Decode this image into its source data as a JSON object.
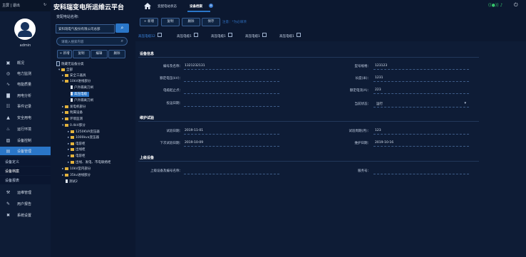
{
  "app": {
    "title": "安科瑞变电所运维云平台",
    "top_left_text": "主屏 | 退出",
    "user": "admin"
  },
  "nav": {
    "items": [
      {
        "label": "概况",
        "icon": "monitor-icon"
      },
      {
        "label": "电力监测",
        "icon": "gauge-icon"
      },
      {
        "label": "电能质量",
        "icon": "wave-icon"
      },
      {
        "label": "用电分析",
        "icon": "bar-chart-icon"
      },
      {
        "label": "事件记录",
        "icon": "clipboard-icon"
      },
      {
        "label": "安全用电",
        "icon": "shield-icon"
      },
      {
        "label": "运行环境",
        "icon": "thermometer-icon"
      },
      {
        "label": "设备控制",
        "icon": "control-icon"
      },
      {
        "label": "设备管理",
        "icon": "device-icon"
      }
    ],
    "sub_items": [
      "设备定义",
      "设备档案",
      "设备报表"
    ],
    "bottom_items": [
      {
        "label": "运维管理",
        "icon": "tools-icon"
      },
      {
        "label": "用户报告",
        "icon": "report-icon"
      },
      {
        "label": "系统设置",
        "icon": "settings-icon"
      }
    ]
  },
  "tree_panel": {
    "unit_label": "变配电站名称:",
    "unit_value": "安科瑞电气股份有限公司总部",
    "search_placeholder": "请输入搜索内容",
    "buttons": [
      "+ 新增",
      "复制",
      "编辑",
      "删除"
    ],
    "nodes": [
      {
        "label": "隐藏无设备分类",
        "depth": 0,
        "kind": "check"
      },
      {
        "label": "全部",
        "depth": 0,
        "kind": "folder"
      },
      {
        "label": "安全工器具",
        "depth": 1,
        "kind": "folder"
      },
      {
        "label": "10kV进线部分",
        "depth": 1,
        "kind": "folder"
      },
      {
        "label": "户外隔离刀闸",
        "depth": 2,
        "kind": "doc"
      },
      {
        "label": "高压电缆",
        "depth": 2,
        "kind": "doc",
        "selected": true
      },
      {
        "label": "户外隔离刀闸",
        "depth": 2,
        "kind": "doc"
      },
      {
        "label": "发电机部分",
        "depth": 1,
        "kind": "folder"
      },
      {
        "label": "附属设备",
        "depth": 1,
        "kind": "folder"
      },
      {
        "label": "环境监测",
        "depth": 1,
        "kind": "folder"
      },
      {
        "label": "0.4kV部分",
        "depth": 1,
        "kind": "folder"
      },
      {
        "label": "1250KVA变压器",
        "depth": 2,
        "kind": "folder"
      },
      {
        "label": "1000kva变压器",
        "depth": 2,
        "kind": "folder"
      },
      {
        "label": "电容柜",
        "depth": 2,
        "kind": "folder"
      },
      {
        "label": "出线柜",
        "depth": 2,
        "kind": "folder"
      },
      {
        "label": "电容柜",
        "depth": 2,
        "kind": "folder"
      },
      {
        "label": "出线、发电、市电联络柜",
        "depth": 2,
        "kind": "folder"
      },
      {
        "label": "10kV室内部分",
        "depth": 1,
        "kind": "folder"
      },
      {
        "label": "35kv进线部分",
        "depth": 1,
        "kind": "folder"
      },
      {
        "label": "测试2",
        "depth": 1,
        "kind": "doc"
      }
    ]
  },
  "top_tabs": [
    {
      "label": "变配电站状态",
      "active": false
    },
    {
      "label": "设备档案",
      "active": true
    }
  ],
  "toolbar": {
    "buttons": [
      "+ 新增",
      "复制",
      "删除",
      "保存"
    ],
    "notice": "注意：*为必填项"
  },
  "device_tabs": [
    {
      "label": "高压电缆12",
      "active": true
    },
    {
      "label": "高压电缆1",
      "active": false
    },
    {
      "label": "高压电缆1",
      "active": false
    },
    {
      "label": "高压电缆1",
      "active": false
    },
    {
      "label": "高压电缆1",
      "active": false
    }
  ],
  "sections": {
    "device_info": "设备信息",
    "maintenance": "维护试验",
    "parent": "上级设备"
  },
  "device_info": {
    "code_label": "编号及名称：",
    "code_value": "1321232131",
    "model_label": "型号规格：",
    "model_value": "123123",
    "voltage_label": "额定电压(kV)：",
    "voltage_value": "",
    "length_label": "长度(米)：",
    "length_value": "1231",
    "endpoint_label": "电缆起止点：",
    "endpoint_value": "",
    "current_label": "额定电流(A)：",
    "current_value": "223",
    "commission_label": "投运日期：",
    "commission_value": "",
    "status_label": "当前状态：",
    "status_value": "运行"
  },
  "maintenance": {
    "test_date_label": "试验日期：",
    "test_date_value": "2019-11-01",
    "test_cycle_label": "试验周期(月)：",
    "test_cycle_value": "123",
    "next_test_label": "下次试验日期：",
    "next_test_value": "2019-10-09",
    "maint_date_label": "维护日期：",
    "maint_date_value": "2019-10-16"
  },
  "parent": {
    "name_label": "上级设备及编号名称：",
    "name_value": "",
    "service_label": "服务号：",
    "service_value": ""
  },
  "colors": {
    "accent": "#2a76c8",
    "background": "#0c1830",
    "panel": "#0e1c36"
  }
}
